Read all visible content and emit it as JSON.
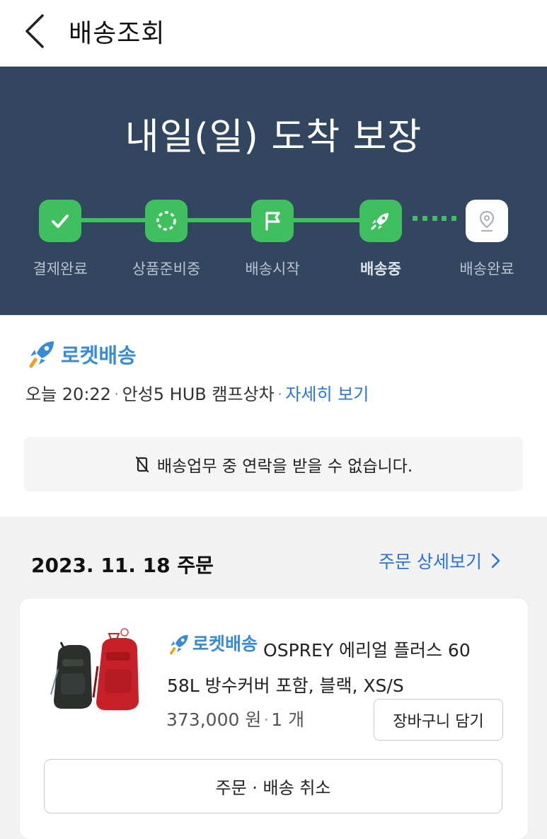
{
  "header": {
    "title": "배송조회"
  },
  "hero": {
    "title": "내일(일) 도착 보장",
    "steps": [
      {
        "label": "결제완료",
        "icon": "check-icon",
        "state": "done"
      },
      {
        "label": "상품준비중",
        "icon": "loading-circle-icon",
        "state": "done"
      },
      {
        "label": "배송시작",
        "icon": "flag-icon",
        "state": "done"
      },
      {
        "label": "배송중",
        "icon": "rocket-icon",
        "state": "current"
      },
      {
        "label": "배송완료",
        "icon": "location-pin-icon",
        "state": "pending"
      }
    ]
  },
  "delivery": {
    "brand": "로켓배송",
    "time": "오늘 20:22",
    "location": "안성5 HUB 캠프상차",
    "detail_link": "자세히 보기",
    "notice": "배송업무 중 연락을 받을 수 없습니다."
  },
  "order": {
    "date_label": "2023. 11. 18 주문",
    "detail_link": "주문 상세보기",
    "product": {
      "badge": "로켓배송",
      "name": "OSPREY 에리얼 플러스 60 58L 방수커버 포함, 블랙, XS/S",
      "price": "373,000 원",
      "quantity": "1 개"
    },
    "cart_button": "장바구니 담기",
    "cancel_button": "주문 · 배송 취소"
  },
  "colors": {
    "hero_bg": "#33465f",
    "progress_green": "#3fbf5e",
    "link_blue": "#2a74d6",
    "rocket_blue": "#3a8bd6"
  }
}
